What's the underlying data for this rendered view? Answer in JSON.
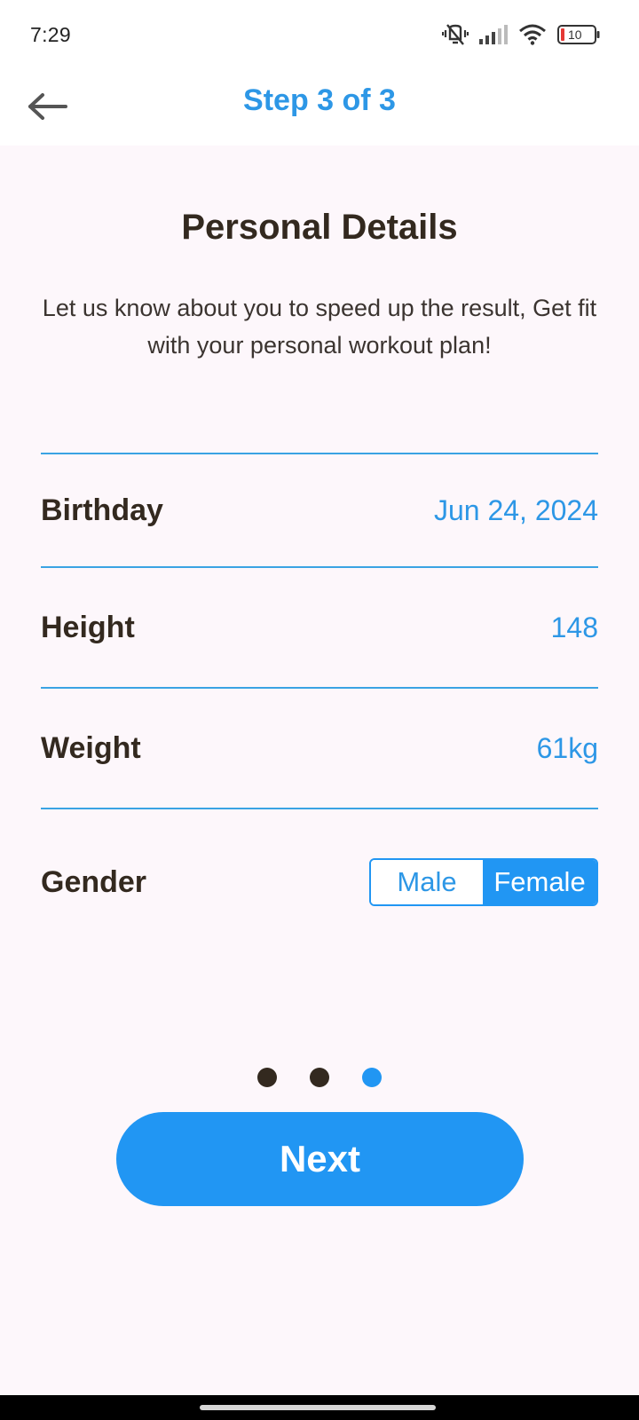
{
  "status_bar": {
    "time": "7:29",
    "battery": "10",
    "icons": [
      "vibrate-mute-icon",
      "signal-icon",
      "wifi-icon",
      "battery-icon"
    ]
  },
  "header": {
    "back_icon": "arrow-left-icon",
    "title": "Step 3 of 3"
  },
  "main": {
    "title": "Personal Details",
    "subtitle": "Let us know about you to speed up the result, Get fit with your personal workout plan!",
    "fields": {
      "birthday": {
        "label": "Birthday",
        "value": "Jun 24, 2024"
      },
      "height": {
        "label": "Height",
        "value": "148"
      },
      "weight": {
        "label": "Weight",
        "value": "61kg"
      },
      "gender": {
        "label": "Gender",
        "options": [
          "Male",
          "Female"
        ],
        "selected": "Female"
      }
    }
  },
  "pager": {
    "total": 3,
    "current": 3
  },
  "actions": {
    "next_label": "Next"
  },
  "colors": {
    "accent": "#2196f3",
    "text_dark": "#33291f",
    "background": "#fdf7fb"
  }
}
